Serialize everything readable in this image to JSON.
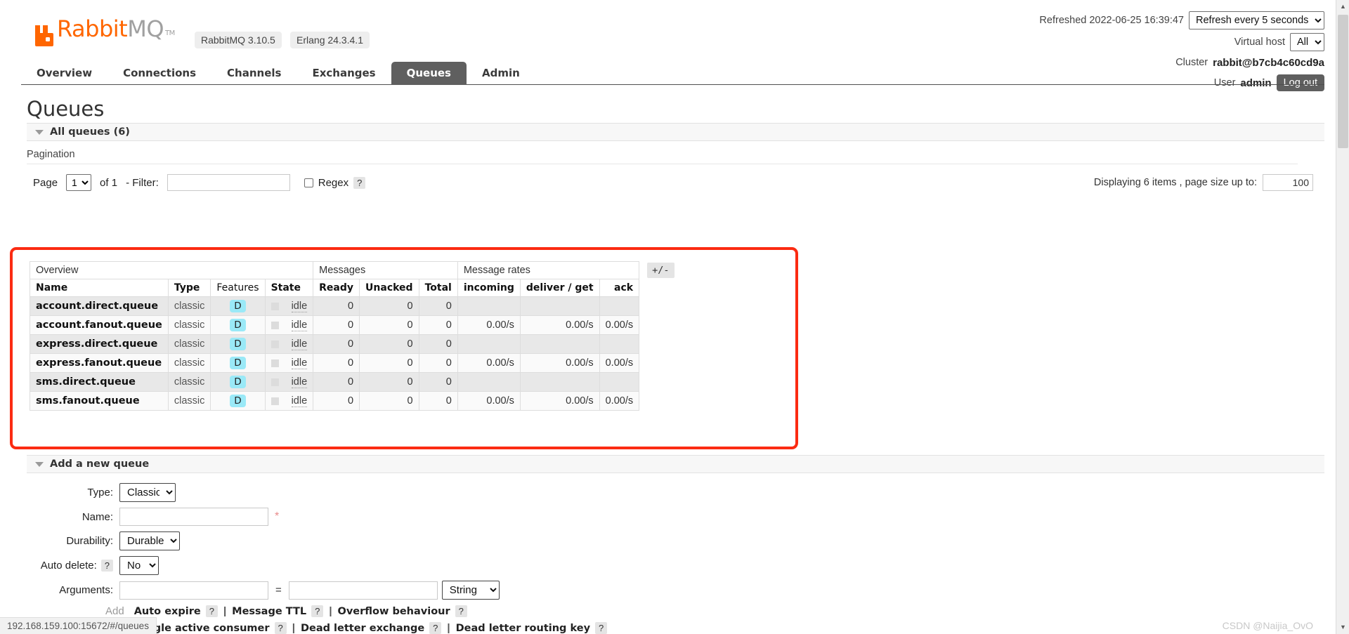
{
  "brand": {
    "name_primary": "Rabbit",
    "name_secondary": "MQ",
    "tm": "TM"
  },
  "versions": {
    "rabbitmq": "RabbitMQ 3.10.5",
    "erlang": "Erlang 24.3.4.1"
  },
  "header": {
    "refreshed_label": "Refreshed 2022-06-25 16:39:47",
    "refresh_select": "Refresh every 5 seconds",
    "vhost_label": "Virtual host",
    "vhost_value": "All",
    "cluster_label": "Cluster",
    "cluster_value": "rabbit@b7cb4c60cd9a",
    "user_label": "User",
    "user_value": "admin",
    "logout_label": "Log out"
  },
  "nav": {
    "tabs": [
      {
        "label": "Overview",
        "active": false
      },
      {
        "label": "Connections",
        "active": false
      },
      {
        "label": "Channels",
        "active": false
      },
      {
        "label": "Exchanges",
        "active": false
      },
      {
        "label": "Queues",
        "active": true
      },
      {
        "label": "Admin",
        "active": false
      }
    ]
  },
  "page": {
    "title": "Queues"
  },
  "all_queues": {
    "section_label": "All queues (6)"
  },
  "pagination": {
    "section_label": "Pagination",
    "page_label": "Page",
    "page_value": "1",
    "of_label": "of 1",
    "filter_label": "- Filter:",
    "filter_value": "",
    "regex_label": "Regex",
    "help": "?",
    "displaying_label": "Displaying 6 items , page size up to:",
    "page_size_value": "100"
  },
  "table": {
    "group_headers": [
      {
        "label": "Overview",
        "span": 4
      },
      {
        "label": "Messages",
        "span": 3
      },
      {
        "label": "Message rates",
        "span": 3
      }
    ],
    "columns": [
      "Name",
      "Type",
      "Features",
      "State",
      "Ready",
      "Unacked",
      "Total",
      "incoming",
      "deliver / get",
      "ack"
    ],
    "plus_minus": "+/-",
    "feature_badge": "D",
    "rows": [
      {
        "name": "account.direct.queue",
        "type": "classic",
        "features": "D",
        "state": "idle",
        "ready": "0",
        "unacked": "0",
        "total": "0",
        "incoming": "",
        "deliver_get": "",
        "ack": ""
      },
      {
        "name": "account.fanout.queue",
        "type": "classic",
        "features": "D",
        "state": "idle",
        "ready": "0",
        "unacked": "0",
        "total": "0",
        "incoming": "0.00/s",
        "deliver_get": "0.00/s",
        "ack": "0.00/s"
      },
      {
        "name": "express.direct.queue",
        "type": "classic",
        "features": "D",
        "state": "idle",
        "ready": "0",
        "unacked": "0",
        "total": "0",
        "incoming": "",
        "deliver_get": "",
        "ack": ""
      },
      {
        "name": "express.fanout.queue",
        "type": "classic",
        "features": "D",
        "state": "idle",
        "ready": "0",
        "unacked": "0",
        "total": "0",
        "incoming": "0.00/s",
        "deliver_get": "0.00/s",
        "ack": "0.00/s"
      },
      {
        "name": "sms.direct.queue",
        "type": "classic",
        "features": "D",
        "state": "idle",
        "ready": "0",
        "unacked": "0",
        "total": "0",
        "incoming": "",
        "deliver_get": "",
        "ack": ""
      },
      {
        "name": "sms.fanout.queue",
        "type": "classic",
        "features": "D",
        "state": "idle",
        "ready": "0",
        "unacked": "0",
        "total": "0",
        "incoming": "0.00/s",
        "deliver_get": "0.00/s",
        "ack": "0.00/s"
      }
    ]
  },
  "add_queue": {
    "section_label": "Add a new queue",
    "type_label": "Type:",
    "type_value": "Classic",
    "name_label": "Name:",
    "name_value": "",
    "required_mark": "*",
    "durability_label": "Durability:",
    "durability_value": "Durable",
    "auto_delete_label": "Auto delete:",
    "auto_delete_value": "No",
    "arguments_label": "Arguments:",
    "arg_key_value": "",
    "arg_val_value": "",
    "arg_type_value": "String",
    "equals": "=",
    "add_label": "Add",
    "help": "?",
    "arg_presets_row1": [
      "Auto expire",
      "Message TTL",
      "Overflow behaviour"
    ],
    "arg_presets_row2": [
      "Single active consumer",
      "Dead letter exchange",
      "Dead letter routing key"
    ],
    "separator": "|"
  },
  "status_bar": {
    "url": "192.168.159.100:15672/#/queues"
  },
  "watermark": {
    "text": "CSDN @Naijia_OvO"
  },
  "colors": {
    "brand_orange": "#ff6600",
    "active_tab": "#5f5f5f",
    "badge_cyan": "#9ae9f7",
    "annotation_red": "#fb2b12"
  }
}
